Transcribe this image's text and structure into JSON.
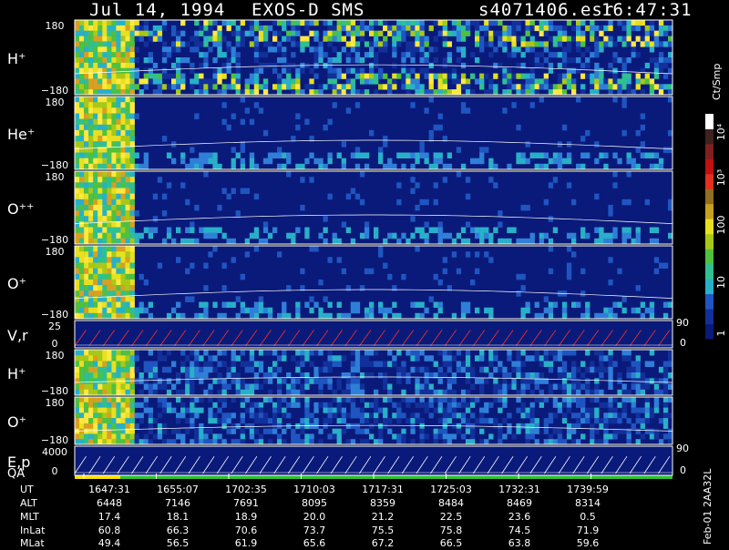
{
  "header": {
    "date": "Jul 14, 1994",
    "instrument": "EXOS-D SMS",
    "file": "s4071406.esr",
    "time": "16:47:31"
  },
  "colorbar": {
    "unit": "Ct/Smp",
    "ticks": [
      "10⁴",
      "10³",
      "100",
      "10",
      "1"
    ]
  },
  "chart_data": {
    "type": "heatmap",
    "panels": [
      {
        "label": "H⁺",
        "ytop": "180",
        "ybottom": "−180",
        "type": "heatmap"
      },
      {
        "label": "He⁺",
        "ytop": "180",
        "ybottom": "−180",
        "type": "heatmap"
      },
      {
        "label": "O⁺⁺",
        "ytop": "180",
        "ybottom": "−180",
        "type": "heatmap"
      },
      {
        "label": "O⁺",
        "ytop": "180",
        "ybottom": "−180",
        "type": "heatmap"
      },
      {
        "label": "V,r",
        "ytop": "25",
        "ybottom": "0",
        "right_top": "90",
        "right_bottom": "0",
        "type": "line"
      },
      {
        "label": "H⁺",
        "ytop": "180",
        "ybottom": "−180",
        "type": "heatmap"
      },
      {
        "label": "O⁺",
        "ytop": "180",
        "ybottom": "−180",
        "type": "heatmap"
      },
      {
        "label": "E,p",
        "label2": "QA",
        "ytop": "4000",
        "ybottom": "0",
        "right_top": "90",
        "right_bottom": "0",
        "type": "line"
      }
    ],
    "x_ticks": {
      "labels": [
        "UT",
        "ALT",
        "MLT",
        "InLat",
        "MLat"
      ],
      "rows": [
        [
          "1647:31",
          "1655:07",
          "1702:35",
          "1710:03",
          "1717:31",
          "1725:03",
          "1732:31",
          "1739:59"
        ],
        [
          "6448",
          "7146",
          "7691",
          "8095",
          "8359",
          "8484",
          "8469",
          "8314"
        ],
        [
          "17.4",
          "18.1",
          "18.9",
          "20.0",
          "21.2",
          "22.5",
          "23.6",
          "0.5"
        ],
        [
          "60.8",
          "66.3",
          "70.6",
          "73.7",
          "75.5",
          "75.8",
          "74.5",
          "71.9"
        ],
        [
          "49.4",
          "56.5",
          "61.9",
          "65.6",
          "67.2",
          "66.5",
          "63.8",
          "59.6"
        ]
      ]
    }
  },
  "footer": {
    "stamp": "Feb-01 2AA32L"
  }
}
